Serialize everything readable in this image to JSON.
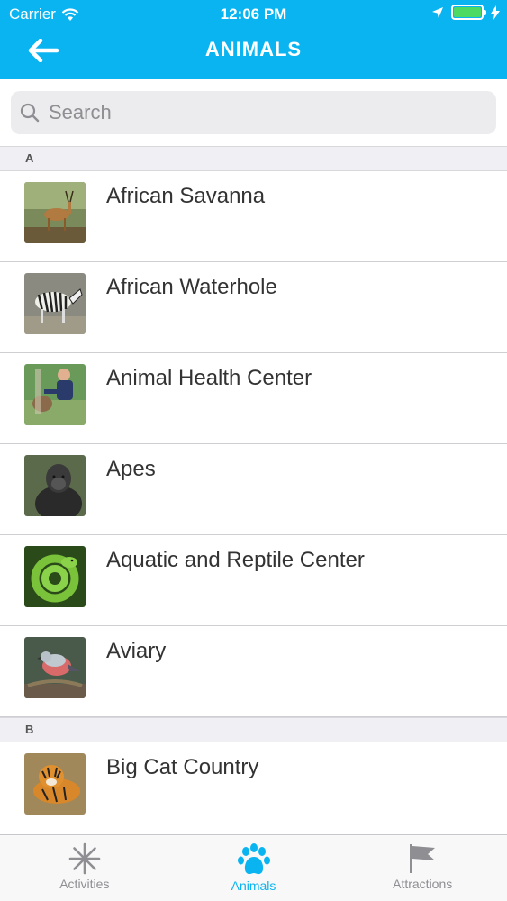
{
  "status_bar": {
    "carrier": "Carrier",
    "time": "12:06 PM"
  },
  "nav": {
    "title": "ANIMALS"
  },
  "search": {
    "placeholder": "Search"
  },
  "sections": [
    {
      "letter": "A",
      "items": [
        {
          "label": "African Savanna",
          "thumb": "antelope-photo"
        },
        {
          "label": "African Waterhole",
          "thumb": "zebra-photo"
        },
        {
          "label": "Animal Health Center",
          "thumb": "vet-photo"
        },
        {
          "label": "Apes",
          "thumb": "gorilla-photo"
        },
        {
          "label": "Aquatic and Reptile Center",
          "thumb": "snake-photo"
        },
        {
          "label": "Aviary",
          "thumb": "bird-photo"
        }
      ]
    },
    {
      "letter": "B",
      "items": [
        {
          "label": "Big Cat Country",
          "thumb": "tiger-photo"
        }
      ]
    }
  ],
  "tabs": [
    {
      "label": "Activities",
      "icon": "asterisk-icon",
      "active": false
    },
    {
      "label": "Animals",
      "icon": "paw-icon",
      "active": true
    },
    {
      "label": "Attractions",
      "icon": "flag-icon",
      "active": false
    }
  ],
  "colors": {
    "accent": "#0ab4f0",
    "inactive_tab": "#8e8e93",
    "battery": "#4cd964"
  }
}
